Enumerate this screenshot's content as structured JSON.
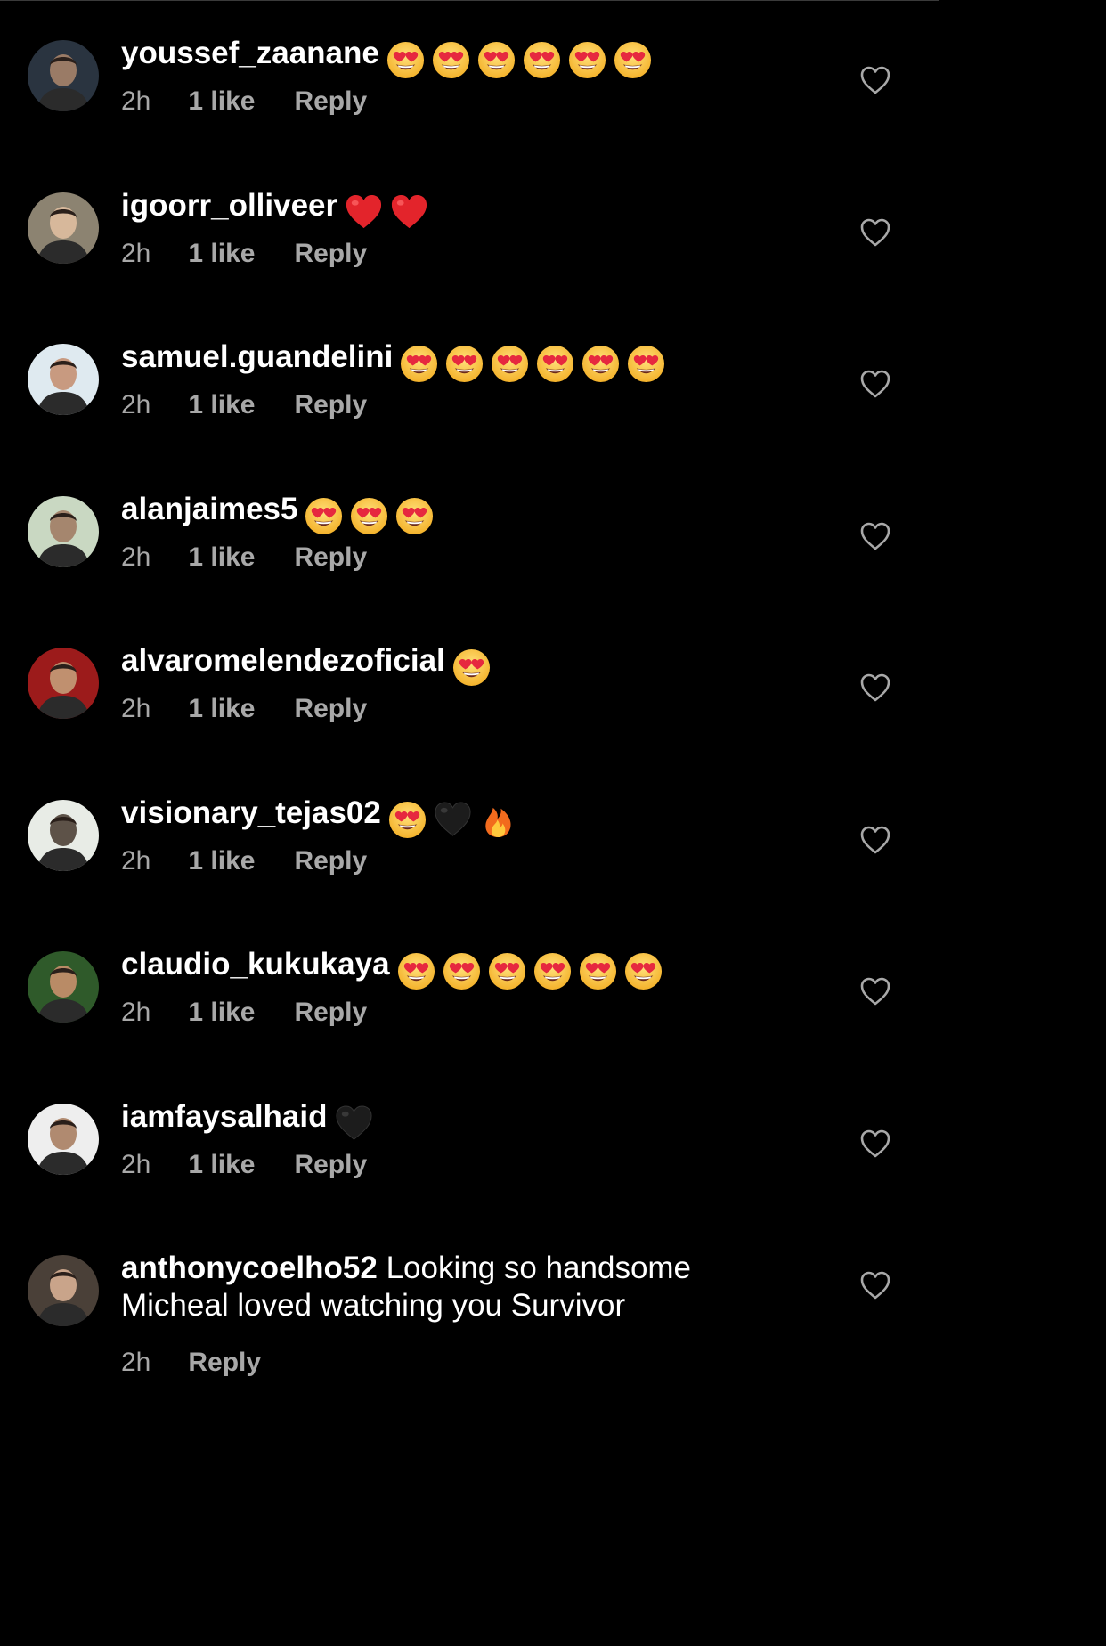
{
  "comments": [
    {
      "username": "youssef_zaanane",
      "emojis": [
        "heart-eyes",
        "heart-eyes",
        "heart-eyes",
        "heart-eyes",
        "heart-eyes",
        "heart-eyes"
      ],
      "time": "2h",
      "likes": "1 like",
      "reply": "Reply",
      "avatar_colors": [
        "#2a3440",
        "#9a7b66"
      ]
    },
    {
      "username": "igoorr_olliveer",
      "emojis": [
        "red-heart",
        "red-heart"
      ],
      "time": "2h",
      "likes": "1 like",
      "reply": "Reply",
      "avatar_colors": [
        "#8c8371",
        "#d7b89b"
      ]
    },
    {
      "username": "samuel.guandelini",
      "emojis": [
        "heart-eyes",
        "heart-eyes",
        "heart-eyes",
        "heart-eyes",
        "heart-eyes",
        "heart-eyes"
      ],
      "time": "2h",
      "likes": "1 like",
      "reply": "Reply",
      "avatar_colors": [
        "#dfeaf0",
        "#c89a80"
      ]
    },
    {
      "username": "alanjaimes5",
      "emojis": [
        "heart-eyes",
        "heart-eyes",
        "heart-eyes"
      ],
      "time": "2h",
      "likes": "1 like",
      "reply": "Reply",
      "avatar_colors": [
        "#c9d8c2",
        "#a5866e"
      ]
    },
    {
      "username": "alvaromelendezoficial",
      "emojis": [
        "heart-eyes"
      ],
      "time": "2h",
      "likes": "1 like",
      "reply": "Reply",
      "avatar_colors": [
        "#9c1b1b",
        "#c0906f"
      ]
    },
    {
      "username": "visionary_tejas02",
      "emojis": [
        "heart-eyes",
        "black-heart",
        "fire"
      ],
      "time": "2h",
      "likes": "1 like",
      "reply": "Reply",
      "avatar_colors": [
        "#e8ece6",
        "#5d5248"
      ]
    },
    {
      "username": "claudio_kukukaya",
      "emojis": [
        "heart-eyes",
        "heart-eyes",
        "heart-eyes",
        "heart-eyes",
        "heart-eyes",
        "heart-eyes"
      ],
      "time": "2h",
      "likes": "1 like",
      "reply": "Reply",
      "avatar_colors": [
        "#2f5a2a",
        "#b98b66"
      ]
    },
    {
      "username": "iamfaysalhaid",
      "emojis": [
        "black-heart"
      ],
      "time": "2h",
      "likes": "1 like",
      "reply": "Reply",
      "avatar_colors": [
        "#eeeeee",
        "#b08a70"
      ]
    },
    {
      "username": "anthonycoelho52",
      "text_line1": "Looking so handsome",
      "text_line2": "Micheal loved watching you Survivor",
      "time": "2h",
      "reply": "Reply",
      "avatar_colors": [
        "#4a4038",
        "#c9a48a"
      ]
    }
  ],
  "colors": {
    "background": "#000000",
    "text": "#ffffff",
    "meta": "#a8a8a8",
    "heart_outline": "#a8a8a8"
  },
  "icons": {
    "like": "heart-outline-icon"
  }
}
